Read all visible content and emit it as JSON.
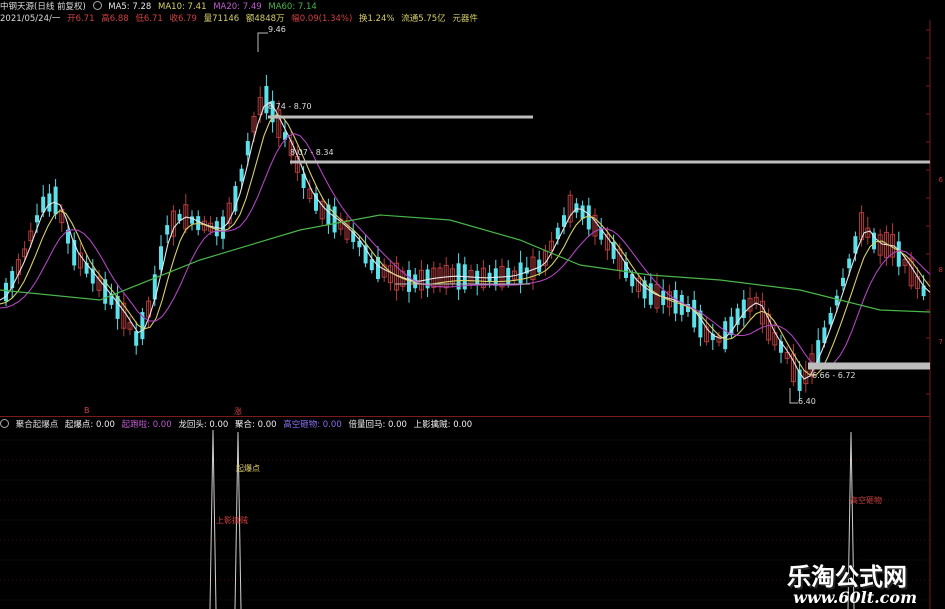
{
  "colors": {
    "up": "#b53b3b",
    "down": "#5ce0ea",
    "ma5": "#e6e6e6",
    "ma10": "#d7d06a",
    "ma20": "#b044c0",
    "ma60": "#49b44a",
    "level": "#bdbdbd",
    "signal": "#cfcfcf"
  },
  "header1": {
    "title": "中钢天源(日线 前复权)",
    "ma5": "MA5: 7.28",
    "ma10": "MA10: 7.41",
    "ma20": "MA20: 7.49",
    "ma60": "MA60: 7.14"
  },
  "header2": {
    "date": "2021/05/24/一",
    "open": "开6.71",
    "high": "高6.88",
    "low": "低6.71",
    "close": "收6.79",
    "volume": "量71146",
    "amount": "额4848万",
    "change": "幅0.09(1.34%)",
    "turnover": "换1.24%",
    "float_cap": "流通5.75亿",
    "sector": "元器件"
  },
  "header3": {
    "indicator": "聚合起爆点",
    "items": [
      "起爆点: 0.00",
      "起跑啦: 0.00",
      "龙回头: 0.00",
      "聚合: 0.00",
      "高空砸物: 0.00",
      "倍量回马: 0.00",
      "上影擒贼: 0.00"
    ]
  },
  "annotations": {
    "high": "9.46",
    "level1": "8.74 - 8.70",
    "level2": "8.07 - 8.34",
    "level3": "6.66 - 6.72",
    "low": "6.40",
    "marker_b": "B",
    "marker_s": "涨",
    "sub_label1": "起爆点",
    "sub_label2": "上影擒贼",
    "sub_label3": "高空砸物"
  },
  "right_axis": [
    "6",
    "8",
    "7"
  ],
  "watermark": {
    "cn": "乐淘公式网",
    "url": "www.60lt.com"
  },
  "ma_values": {
    "ma5": 7.28,
    "ma10": 7.41,
    "ma20": 7.49,
    "ma60": 7.14
  }
}
